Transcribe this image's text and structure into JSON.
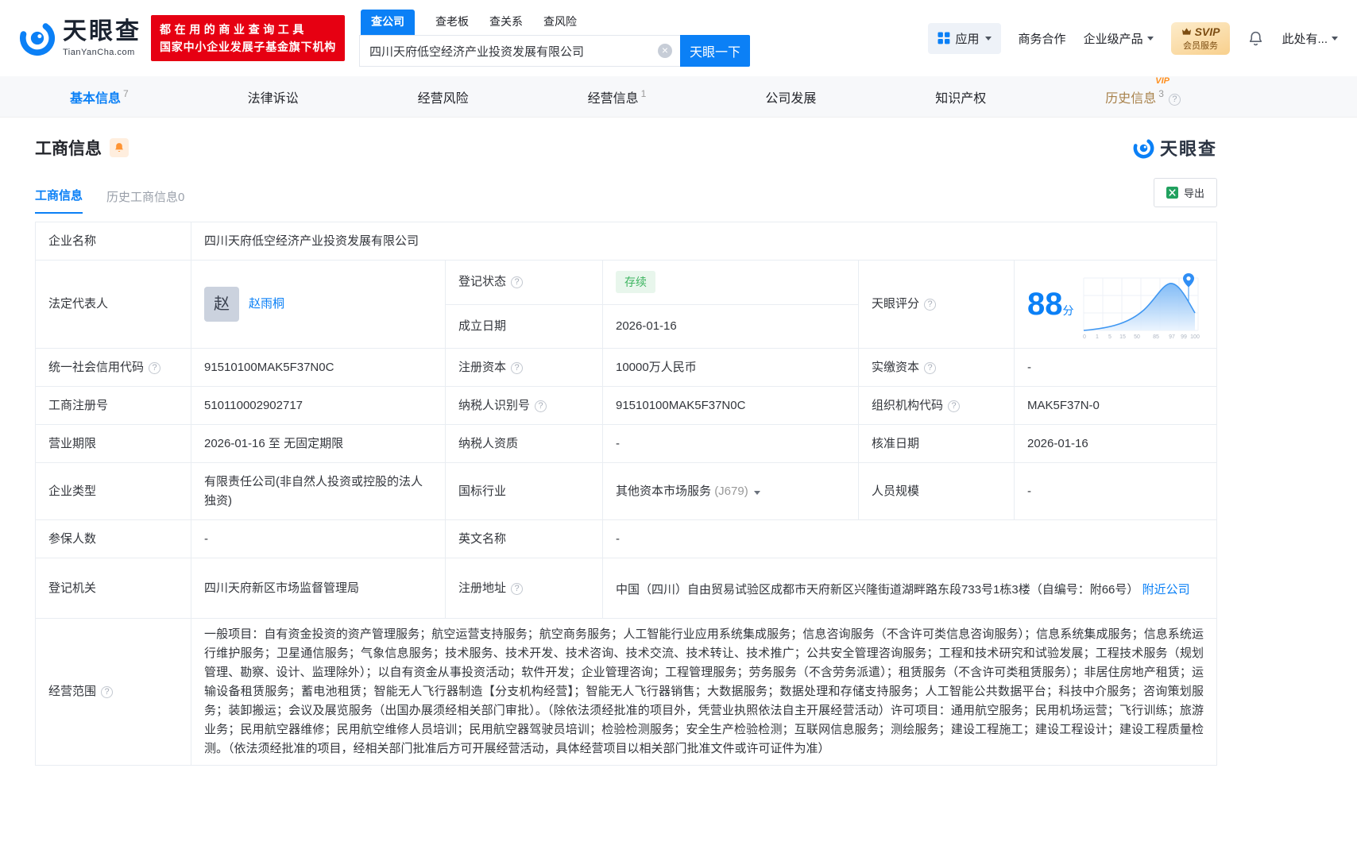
{
  "header": {
    "logo": {
      "cn": "天眼查",
      "en": "TianYanCha.com"
    },
    "promo": {
      "line1": "都在用的商业查询工具",
      "line2": "国家中小企业发展子基金旗下机构"
    },
    "search_tabs": [
      {
        "label": "查公司"
      },
      {
        "label": "查老板"
      },
      {
        "label": "查关系"
      },
      {
        "label": "查风险"
      }
    ],
    "search": {
      "value": "四川天府低空经济产业投资发展有限公司",
      "button": "天眼一下"
    },
    "apps_label": "应用",
    "menu": {
      "cooperation": "商务合作",
      "enterprise": "企业级产品",
      "account": "此处有..."
    },
    "svip": {
      "line1": "SVIP",
      "line2": "会员服务"
    }
  },
  "nav": {
    "vip_tag": "VIP",
    "items": [
      {
        "label": "基本信息",
        "count": "7"
      },
      {
        "label": "法律诉讼",
        "count": ""
      },
      {
        "label": "经营风险",
        "count": ""
      },
      {
        "label": "经营信息",
        "count": "1"
      },
      {
        "label": "公司发展",
        "count": ""
      },
      {
        "label": "知识产权",
        "count": ""
      },
      {
        "label": "历史信息",
        "count": "3"
      }
    ]
  },
  "section": {
    "title": "工商信息",
    "watermark": "天眼查",
    "tab_current": "工商信息",
    "tab_history": "历史工商信息0",
    "export_label": "导出"
  },
  "info": {
    "company_name_label": "企业名称",
    "company_name": "四川天府低空经济产业投资发展有限公司",
    "legal_rep_label": "法定代表人",
    "legal_rep_avatar": "赵",
    "legal_rep_name": "赵雨桐",
    "reg_status_label": "登记状态",
    "reg_status": "存续",
    "establish_date_label": "成立日期",
    "establish_date": "2026-01-16",
    "score_label": "天眼评分",
    "credit_code_label": "统一社会信用代码",
    "credit_code": "91510100MAK5F37N0C",
    "reg_capital_label": "注册资本",
    "reg_capital": "10000万人民币",
    "paid_capital_label": "实缴资本",
    "paid_capital": "-",
    "reg_number_label": "工商注册号",
    "reg_number": "510110002902717",
    "taxpayer_id_label": "纳税人识别号",
    "taxpayer_id": "91510100MAK5F37N0C",
    "org_code_label": "组织机构代码",
    "org_code": "MAK5F37N-0",
    "term_label": "营业期限",
    "term": "2026-01-16 至 无固定期限",
    "taxpayer_quality_label": "纳税人资质",
    "taxpayer_quality": "-",
    "approval_date_label": "核准日期",
    "approval_date": "2026-01-16",
    "company_type_label": "企业类型",
    "company_type": "有限责任公司(非自然人投资或控股的法人独资)",
    "industry_label": "国标行业",
    "industry": "其他资本市场服务",
    "industry_code": "(J679)",
    "staff_label": "人员规模",
    "staff": "-",
    "insured_label": "参保人数",
    "insured": "-",
    "en_name_label": "英文名称",
    "en_name": "-",
    "authority_label": "登记机关",
    "authority": "四川天府新区市场监督管理局",
    "address_label": "注册地址",
    "address": "中国（四川）自由贸易试验区成都市天府新区兴隆街道湖畔路东段733号1栋3楼（自编号：附66号）",
    "nearby": "附近公司",
    "scope_label": "经营范围",
    "scope": "一般项目：自有资金投资的资产管理服务；航空运营支持服务；航空商务服务；人工智能行业应用系统集成服务；信息咨询服务（不含许可类信息咨询服务）；信息系统集成服务；信息系统运行维护服务；卫星通信服务；气象信息服务；技术服务、技术开发、技术咨询、技术交流、技术转让、技术推广；公共安全管理咨询服务；工程和技术研究和试验发展；工程技术服务（规划管理、勘察、设计、监理除外）；以自有资金从事投资活动；软件开发；企业管理咨询；工程管理服务；劳务服务（不含劳务派遣）；租赁服务（不含许可类租赁服务）；非居住房地产租赁；运输设备租赁服务；蓄电池租赁；智能无人飞行器制造【分支机构经营】；智能无人飞行器销售；大数据服务；数据处理和存储支持服务；人工智能公共数据平台；科技中介服务；咨询策划服务；装卸搬运；会议及展览服务（出国办展须经相关部门审批）。（除依法须经批准的项目外，凭营业执照依法自主开展经营活动）许可项目：通用航空服务；民用机场运营；飞行训练；旅游业务；民用航空器维修；民用航空维修人员培训；民用航空器驾驶员培训；检验检测服务；安全生产检验检测；互联网信息服务；测绘服务；建设工程施工；建设工程设计；建设工程质量检测。（依法须经批准的项目，经相关部门批准后方可开展经营活动，具体经营项目以相关部门批准文件或许可证件为准）"
  },
  "score": {
    "value": "88",
    "unit": "分",
    "ticks": [
      "0",
      "1",
      "5",
      "15",
      "50",
      "85",
      "97",
      "99",
      "100"
    ]
  }
}
